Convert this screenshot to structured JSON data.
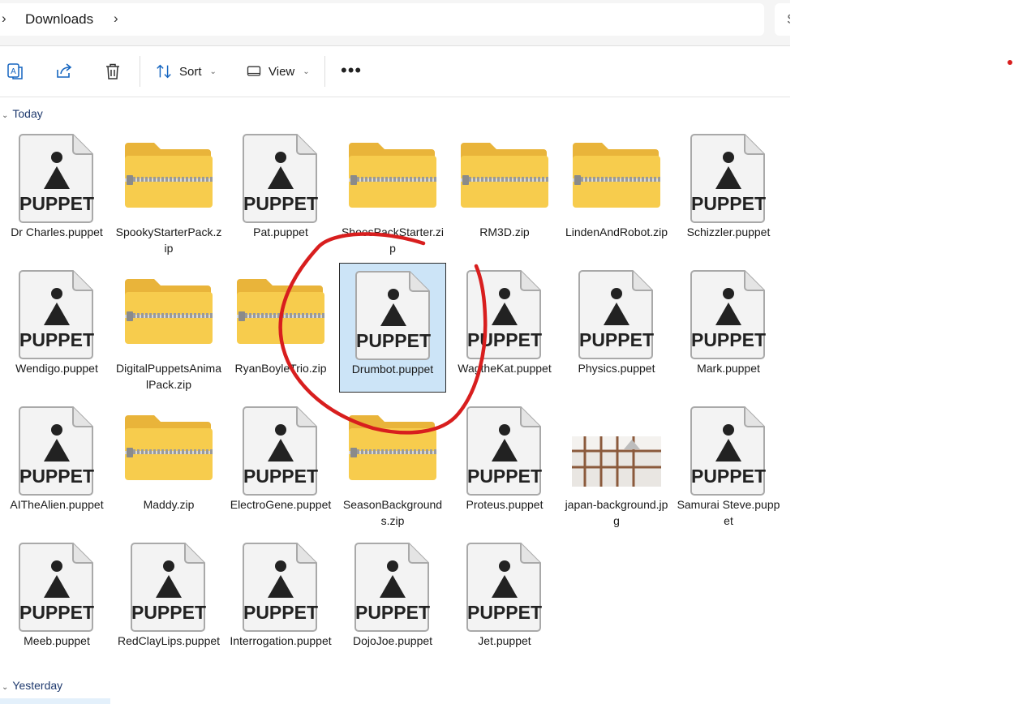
{
  "address": {
    "path": [
      "Downloads"
    ],
    "search_peek": "S"
  },
  "toolbar": {
    "sort_label": "Sort",
    "view_label": "View"
  },
  "groups": {
    "today": "Today",
    "yesterday": "Yesterday"
  },
  "thumb_text": {
    "puppet": "PUPPET"
  },
  "files": [
    {
      "name": "Dr Charles.puppet",
      "type": "puppet"
    },
    {
      "name": "SpookyStarterPack.zip",
      "type": "zip"
    },
    {
      "name": "Pat.puppet",
      "type": "puppet"
    },
    {
      "name": "ShoesPackStarter.zip",
      "type": "zip"
    },
    {
      "name": "RM3D.zip",
      "type": "zip"
    },
    {
      "name": "LindenAndRobot.zip",
      "type": "zip"
    },
    {
      "name": "Schizzler.puppet",
      "type": "puppet"
    },
    {
      "name": "Wendigo.puppet",
      "type": "puppet"
    },
    {
      "name": "DigitalPuppetsAnimalPack.zip",
      "type": "zip"
    },
    {
      "name": "RyanBoyleTrio.zip",
      "type": "zip"
    },
    {
      "name": "Drumbot.puppet",
      "type": "puppet",
      "selected": true
    },
    {
      "name": "WagtheKat.puppet",
      "type": "puppet"
    },
    {
      "name": "Physics.puppet",
      "type": "puppet"
    },
    {
      "name": "Mark.puppet",
      "type": "puppet"
    },
    {
      "name": "AITheAlien.puppet",
      "type": "puppet"
    },
    {
      "name": "Maddy.zip",
      "type": "zip"
    },
    {
      "name": "ElectroGene.puppet",
      "type": "puppet"
    },
    {
      "name": "SeasonBackgrounds.zip",
      "type": "zip"
    },
    {
      "name": "Proteus.puppet",
      "type": "puppet"
    },
    {
      "name": "japan-background.jpg",
      "type": "jpg"
    },
    {
      "name": "Samurai Steve.puppet",
      "type": "puppet"
    },
    {
      "name": "Meeb.puppet",
      "type": "puppet"
    },
    {
      "name": "RedClayLips.puppet",
      "type": "puppet"
    },
    {
      "name": "Interrogation.puppet",
      "type": "puppet"
    },
    {
      "name": "DojoJoe.puppet",
      "type": "puppet"
    },
    {
      "name": "Jet.puppet",
      "type": "puppet"
    }
  ],
  "annotation": {
    "color": "#d81e1e"
  },
  "colors": {
    "folder": "#f7c844",
    "selection": "#cce4f7",
    "group_header": "#1f3a6e"
  },
  "icons": [
    "chevron-right-icon",
    "ai-translate-icon",
    "share-icon",
    "delete-icon",
    "sort-icon",
    "view-icon",
    "more-icon",
    "puppet-file-icon",
    "zip-folder-icon",
    "image-thumbnail"
  ]
}
